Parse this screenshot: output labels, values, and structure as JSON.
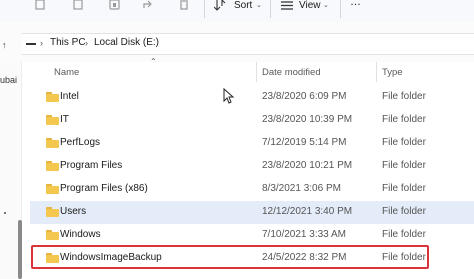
{
  "toolbar": {
    "sort_label": "Sort",
    "view_label": "View",
    "more_label": "…"
  },
  "address": {
    "crumbs": [
      "This PC",
      "Local Disk (E:)"
    ]
  },
  "nav": {
    "partial_label": "ubai"
  },
  "columns": {
    "name": "Name",
    "date": "Date modified",
    "type": "Type"
  },
  "rows": [
    {
      "name": "Intel",
      "date": "23/8/2020 6:09 PM",
      "type": "File folder"
    },
    {
      "name": "IT",
      "date": "23/8/2020 10:39 PM",
      "type": "File folder"
    },
    {
      "name": "PerfLogs",
      "date": "7/12/2019 5:14 PM",
      "type": "File folder"
    },
    {
      "name": "Program Files",
      "date": "23/8/2020 10:21 PM",
      "type": "File folder"
    },
    {
      "name": "Program Files (x86)",
      "date": "8/3/2021 3:06 PM",
      "type": "File folder"
    },
    {
      "name": "Users",
      "date": "12/12/2021 3:40 PM",
      "type": "File folder"
    },
    {
      "name": "Windows",
      "date": "7/10/2021 3:33 AM",
      "type": "File folder"
    },
    {
      "name": "WindowsImageBackup",
      "date": "24/5/2022 8:32 PM",
      "type": "File folder"
    }
  ],
  "selected_row": "Users",
  "highlighted_row": "WindowsImageBackup",
  "colors": {
    "folder": "#f4c74e",
    "selection": "#e3ecf8",
    "highlight_border": "#d9343a"
  }
}
